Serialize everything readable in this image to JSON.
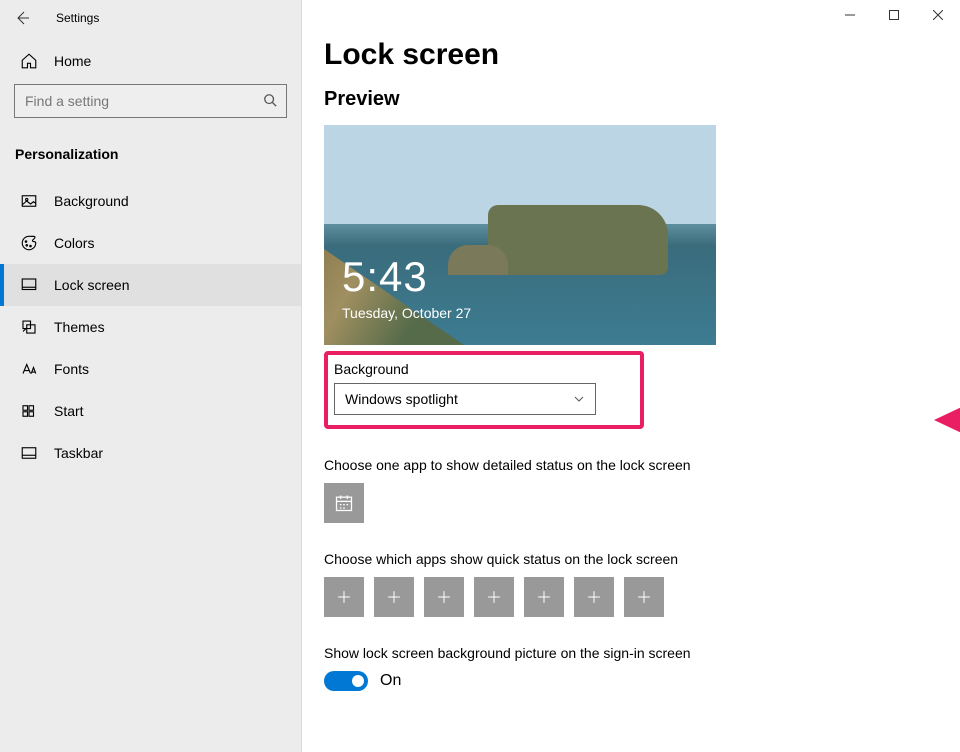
{
  "window": {
    "title": "Settings"
  },
  "sidebar": {
    "home": "Home",
    "search_placeholder": "Find a setting",
    "category": "Personalization",
    "items": [
      {
        "label": "Background",
        "icon": "background"
      },
      {
        "label": "Colors",
        "icon": "colors"
      },
      {
        "label": "Lock screen",
        "icon": "lockscreen",
        "active": true
      },
      {
        "label": "Themes",
        "icon": "themes"
      },
      {
        "label": "Fonts",
        "icon": "fonts"
      },
      {
        "label": "Start",
        "icon": "start"
      },
      {
        "label": "Taskbar",
        "icon": "taskbar"
      }
    ]
  },
  "page": {
    "title": "Lock screen",
    "preview_label": "Preview",
    "preview_time": "5:43",
    "preview_date": "Tuesday, October 27",
    "background_label": "Background",
    "background_value": "Windows spotlight",
    "detailed_label": "Choose one app to show detailed status on the lock screen",
    "quick_label": "Choose which apps show quick status on the lock screen",
    "signin_label": "Show lock screen background picture on the sign-in screen",
    "signin_state": "On"
  },
  "annotation": {
    "highlight_color": "#e91e63"
  }
}
